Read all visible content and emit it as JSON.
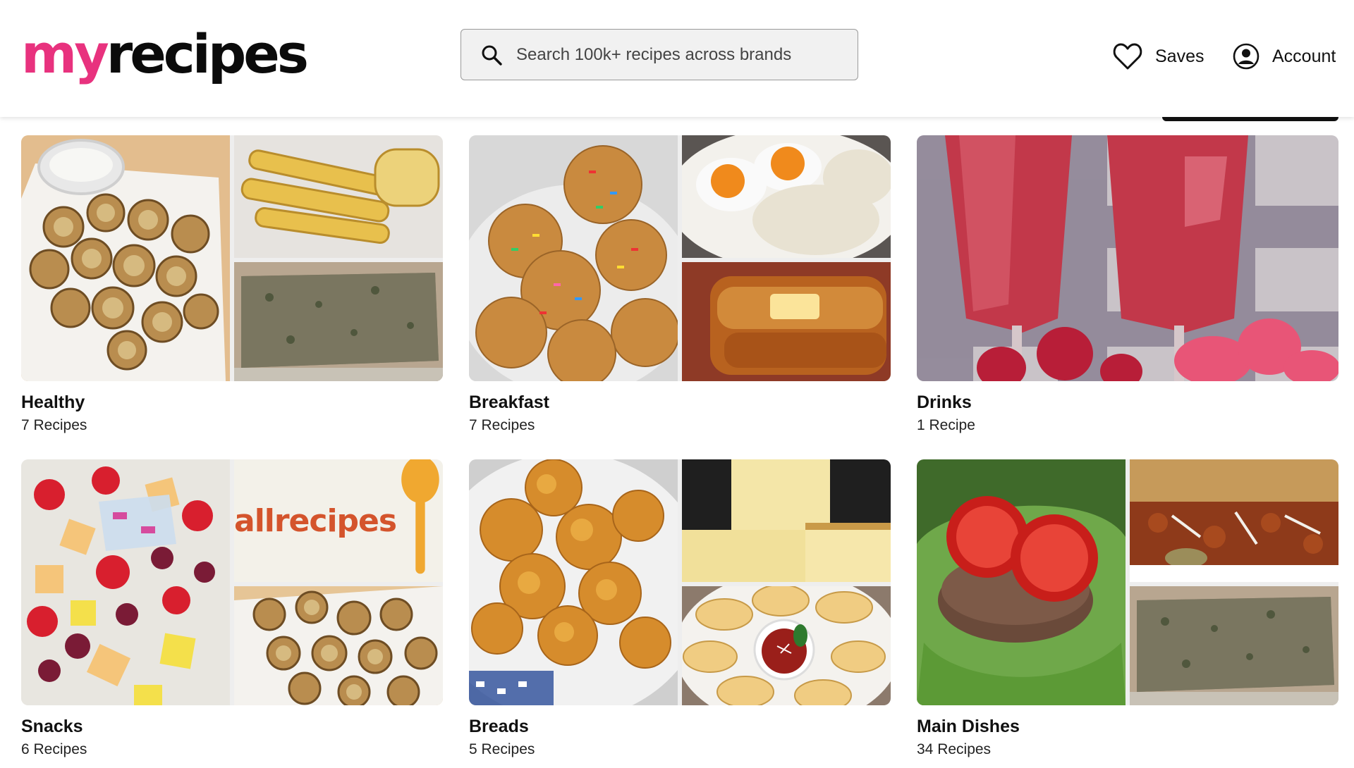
{
  "brand": {
    "logo_my": "my",
    "logo_rest": "recipes",
    "accent": "#e8327e"
  },
  "search": {
    "placeholder": "Search 100k+ recipes across brands",
    "value": ""
  },
  "nav": {
    "saves_label": "Saves",
    "account_label": "Account"
  },
  "collections": [
    {
      "title": "Healthy",
      "count": "7 Recipes"
    },
    {
      "title": "Breakfast",
      "count": "7 Recipes"
    },
    {
      "title": "Drinks",
      "count": "1 Recipe"
    },
    {
      "title": "Snacks",
      "count": "6 Recipes",
      "placeholder_logo": "allrecipes"
    },
    {
      "title": "Breads",
      "count": "5 Recipes"
    },
    {
      "title": "Main Dishes",
      "count": "34 Recipes"
    }
  ]
}
